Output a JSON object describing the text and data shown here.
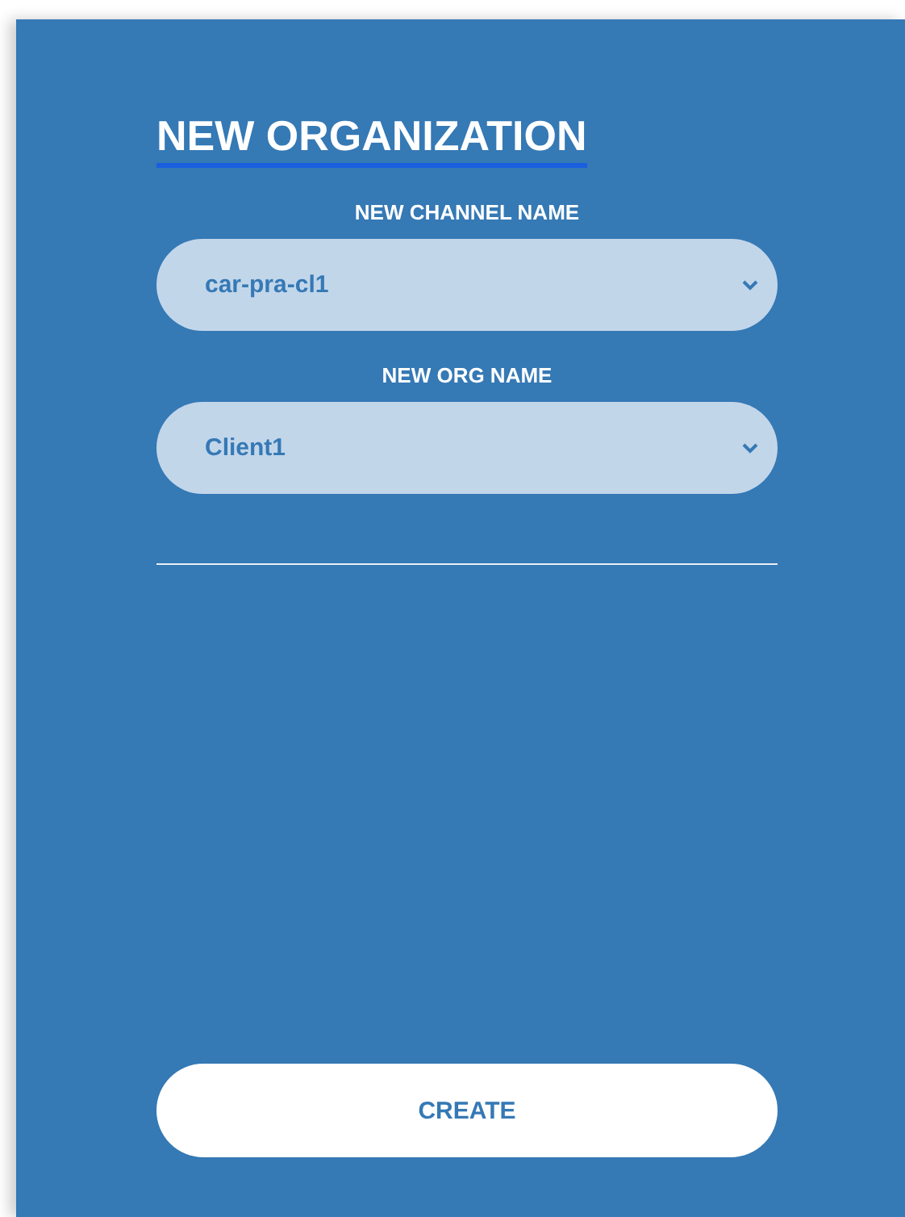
{
  "title": "NEW ORGANIZATION",
  "fields": [
    {
      "label": "NEW CHANNEL NAME",
      "value": "car-pra-cl1"
    },
    {
      "label": "NEW ORG NAME",
      "value": "Client1"
    }
  ],
  "button": "CREATE"
}
